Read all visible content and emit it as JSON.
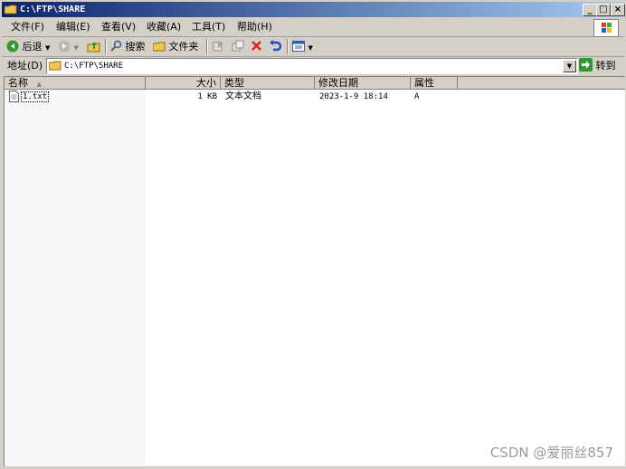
{
  "window": {
    "title": "C:\\FTP\\SHARE"
  },
  "title_buttons": {
    "minimize": "_",
    "maximize": "□",
    "close": "×"
  },
  "menu": [
    "文件(F)",
    "编辑(E)",
    "查看(V)",
    "收藏(A)",
    "工具(T)",
    "帮助(H)"
  ],
  "toolbar": {
    "back": "后退",
    "search": "搜索",
    "folders": "文件夹"
  },
  "address": {
    "label": "地址(D)",
    "value": "C:\\FTP\\SHARE",
    "go": "转到"
  },
  "columns": [
    "名称",
    "大小",
    "类型",
    "修改日期",
    "属性"
  ],
  "files": [
    {
      "name": "1.txt",
      "size": "1 KB",
      "type": "文本文档",
      "modified": "2023-1-9 18:14",
      "attr": "A"
    }
  ],
  "watermark": "CSDN @爱丽丝857",
  "colors": {
    "title_start": "#0a246a",
    "title_end": "#a6caf0",
    "chrome": "#d4d0c8"
  }
}
